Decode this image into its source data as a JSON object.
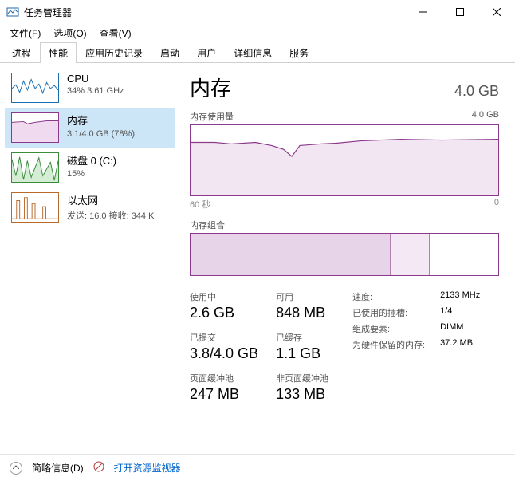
{
  "window": {
    "title": "任务管理器"
  },
  "menu": {
    "file": "文件(F)",
    "options": "选项(O)",
    "view": "查看(V)"
  },
  "tabs": {
    "processes": "进程",
    "performance": "性能",
    "history": "应用历史记录",
    "startup": "启动",
    "users": "用户",
    "details": "详细信息",
    "services": "服务"
  },
  "sidebar": {
    "cpu": {
      "name": "CPU",
      "sub": "34% 3.61 GHz"
    },
    "memory": {
      "name": "内存",
      "sub": "3.1/4.0 GB (78%)"
    },
    "disk": {
      "name": "磁盘 0 (C:)",
      "sub": "15%"
    },
    "ethernet": {
      "name": "以太网",
      "sub": "发送: 16.0 接收: 344 K"
    }
  },
  "main": {
    "title": "内存",
    "capacity": "4.0 GB",
    "usage_label": "内存使用量",
    "usage_max": "4.0 GB",
    "axis_left": "60 秒",
    "axis_right": "0",
    "composition_label": "内存组合",
    "stats": {
      "in_use": {
        "label": "使用中",
        "value": "2.6 GB"
      },
      "available": {
        "label": "可用",
        "value": "848 MB"
      },
      "committed": {
        "label": "已提交",
        "value": "3.8/4.0 GB"
      },
      "cached": {
        "label": "已缓存",
        "value": "1.1 GB"
      },
      "paged": {
        "label": "页面缓冲池",
        "value": "247 MB"
      },
      "nonpaged": {
        "label": "非页面缓冲池",
        "value": "133 MB"
      }
    },
    "info": {
      "speed": {
        "label": "速度:",
        "value": "2133 MHz"
      },
      "slots": {
        "label": "已使用的插槽:",
        "value": "1/4"
      },
      "form": {
        "label": "组成要素:",
        "value": "DIMM"
      },
      "reserved": {
        "label": "为硬件保留的内存:",
        "value": "37.2 MB"
      }
    }
  },
  "footer": {
    "fewer": "简略信息(D)",
    "resmon": "打开资源监视器"
  },
  "chart_data": {
    "type": "line",
    "title": "内存使用量",
    "ylabel": "GB",
    "ylim": [
      0,
      4.0
    ],
    "xlim_seconds": [
      60,
      0
    ],
    "values_gb": [
      3.1,
      3.1,
      3.05,
      3.1,
      3.1,
      3.0,
      3.1,
      3.0,
      2.6,
      2.9,
      3.1,
      3.05,
      3.1,
      3.1,
      3.15,
      3.2,
      3.2,
      3.2,
      3.2,
      3.2,
      3.15,
      3.2,
      3.2,
      3.2,
      3.2,
      3.2,
      3.2,
      3.2,
      3.2,
      3.2
    ],
    "composition": {
      "in_use_gb": 2.6,
      "modified_gb": 0.5,
      "standby_free_gb": 0.9,
      "total_gb": 4.0
    }
  }
}
